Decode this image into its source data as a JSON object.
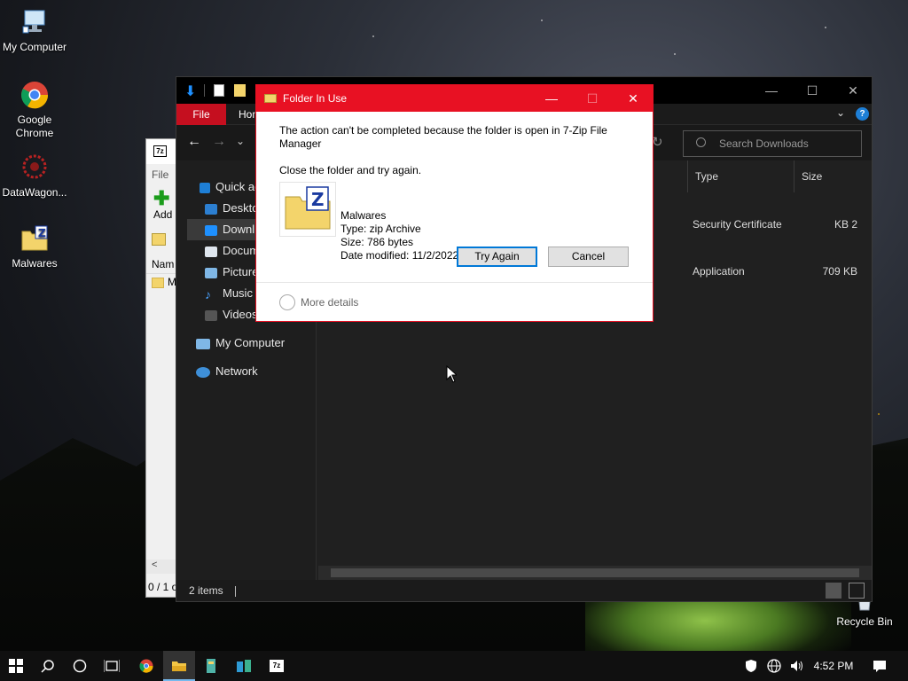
{
  "desktop": {
    "icons": [
      {
        "label": "My Computer"
      },
      {
        "label": "Google Chrome"
      },
      {
        "label": "DataWagon..."
      },
      {
        "label": "Malwares"
      },
      {
        "label": "Recycle Bin"
      }
    ]
  },
  "zip_window": {
    "menu_file": "File",
    "add_label": "Add",
    "col_name": "Nam",
    "row_prefix": "M",
    "status": "0 / 1 o"
  },
  "explorer": {
    "tabs": {
      "file": "File",
      "home": "Hom"
    },
    "search_placeholder": "Search Downloads",
    "nav": {
      "quick_access": "Quick ac",
      "desktop": "Deskto",
      "downloads": "Downl",
      "documents": "Docum",
      "pictures": "Picture",
      "music": "Music",
      "videos": "Videos",
      "my_computer": "My Computer",
      "network": "Network"
    },
    "columns": {
      "type": "Type",
      "size": "Size"
    },
    "rows": [
      {
        "type": "Security Certificate",
        "size": "2 KB"
      },
      {
        "type": "Application",
        "size": "709 KB"
      }
    ],
    "status": "2 items"
  },
  "dialog": {
    "title": "Folder In Use",
    "message": "The action can't be completed because the folder is open in 7-Zip File Manager",
    "instruction": "Close the folder and try again.",
    "file": {
      "name": "Malwares",
      "type": "Type: zip Archive",
      "size": "Size: 786 bytes",
      "modified": "Date modified: 11/2/2022 4:50 PM"
    },
    "try_again": "Try Again",
    "cancel": "Cancel",
    "more_details": "More details"
  },
  "taskbar": {
    "clock": "4:52 PM"
  },
  "colors": {
    "accent_red": "#e81123",
    "file_tab": "#c50f1f",
    "taskbar": "#101010"
  }
}
